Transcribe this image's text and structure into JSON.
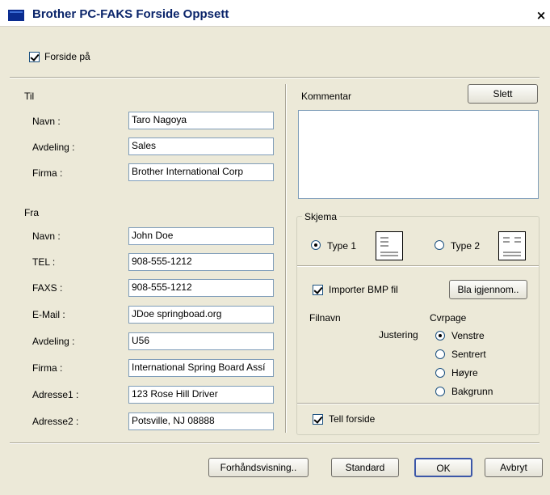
{
  "window": {
    "title": "Brother PC-FAKS Forside Oppsett",
    "close_glyph": "×"
  },
  "cover_on": {
    "label": "Forside på",
    "checked": true
  },
  "to": {
    "heading": "Til",
    "name_label": "Navn :",
    "name_value": "Taro Nagoya",
    "dept_label": "Avdeling :",
    "dept_value": "Sales",
    "company_label": "Firma :",
    "company_value": "Brother International Corp"
  },
  "from": {
    "heading": "Fra",
    "name_label": "Navn :",
    "name_value": "John Doe",
    "tel_label": "TEL :",
    "tel_value": "908-555-1212",
    "fax_label": "FAXS :",
    "fax_value": "908-555-1212",
    "email_label": "E-Mail :",
    "email_value": "JDoe springboad.org",
    "dept_label": "Avdeling :",
    "dept_value": "U56",
    "company_label": "Firma :",
    "company_value": "International Spring Board Assí",
    "address1_label": "Adresse1 :",
    "address1_value": "123 Rose Hill Driver",
    "address2_label": "Adresse2 :",
    "address2_value": "Potsville, NJ 08888"
  },
  "comment": {
    "label": "Kommentar",
    "clear_button": "Slett",
    "value": ""
  },
  "schema": {
    "heading": "Skjema",
    "type1_label": "Type 1",
    "type2_label": "Type 2",
    "selected": "Type 1",
    "import_bmp_label": "Importer BMP fil",
    "import_bmp_checked": true,
    "browse_button": "Bla igjennom..",
    "filename_label": "Filnavn",
    "filename_value": "Cvrpage",
    "alignment_label": "Justering",
    "alignment_options": [
      "Venstre",
      "Sentrert",
      "Høyre",
      "Bakgrunn"
    ],
    "alignment_selected": "Venstre",
    "count_cover_label": "Tell forside",
    "count_cover_checked": true
  },
  "buttons": {
    "preview": "Forhåndsvisning..",
    "default": "Standard",
    "ok": "OK",
    "cancel": "Avbryt"
  }
}
